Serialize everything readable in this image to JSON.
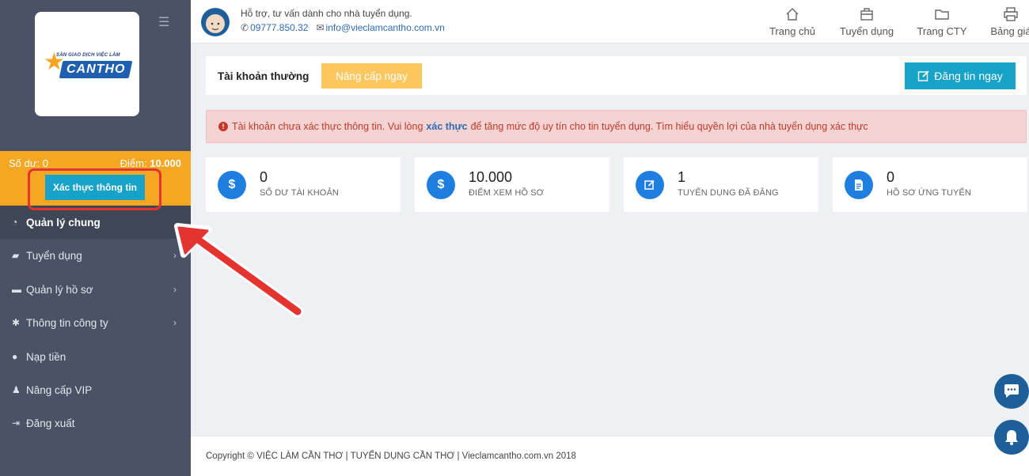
{
  "brand": {
    "logo_tagline": "SÀN GIAO DỊCH VIỆC LÀM",
    "logo_name": "CANTHO"
  },
  "sidebar": {
    "balance_label": "Số dư:",
    "balance_value": "0",
    "points_label": "Điểm:",
    "points_value": "10.000",
    "verify_button": "Xác thực thông tin",
    "items": [
      {
        "label": "Quản lý chung",
        "icon": "dashboard-icon",
        "active": true
      },
      {
        "label": "Tuyển dụng",
        "icon": "briefcase-icon",
        "has_submenu": true
      },
      {
        "label": "Quản lý hồ sơ",
        "icon": "folder-icon",
        "has_submenu": true
      },
      {
        "label": "Thông tin công ty",
        "icon": "gear-icon",
        "has_submenu": true
      },
      {
        "label": "Nạp tiền",
        "icon": "dollar-icon"
      },
      {
        "label": "Nâng cấp VIP",
        "icon": "user-icon"
      },
      {
        "label": "Đăng xuất",
        "icon": "sign-out-icon"
      }
    ]
  },
  "header": {
    "support_text": "Hỗ trợ, tư vấn dành cho nhà tuyển dụng.",
    "phone": "09777.850.32",
    "email": "info@vieclamcantho.com.vn",
    "nav": [
      {
        "label": "Trang chủ",
        "icon": "home-icon"
      },
      {
        "label": "Tuyển dụng",
        "icon": "briefcase-icon"
      },
      {
        "label": "Trang CTY",
        "icon": "folder-icon"
      },
      {
        "label": "Bảng giá",
        "icon": "printer-icon"
      }
    ]
  },
  "account": {
    "type_label": "Tài khoản thường",
    "upgrade_button": "Nâng cấp ngay",
    "post_button": "Đăng tin ngay"
  },
  "alert": {
    "text_before": "Tài khoản chưa xác thực thông tin. Vui lòng",
    "link": "xác thực",
    "text_after": "để tăng mức độ uy tín cho tin tuyển dụng. Tìm hiểu quyền lợi của nhà tuyển dụng xác thực"
  },
  "stats": [
    {
      "value": "0",
      "label": "SỐ DƯ TÀI KHOẢN",
      "icon": "dollar-icon"
    },
    {
      "value": "10.000",
      "label": "ĐIỂM XEM HỒ SƠ",
      "icon": "dollar-icon"
    },
    {
      "value": "1",
      "label": "TUYỂN DỤNG ĐÃ ĐĂNG",
      "icon": "edit-icon"
    },
    {
      "value": "0",
      "label": "HỒ SƠ ỨNG TUYỂN",
      "icon": "document-icon"
    }
  ],
  "footer": {
    "text": "Copyright © VIỆC LÀM CẦN THƠ | TUYỂN DỤNG CẦN THƠ | Vieclamcantho.com.vn 2018"
  },
  "colors": {
    "sidebar_bg": "#4a5366",
    "accent_orange": "#f5a623",
    "primary_blue": "#17a2c8",
    "stat_icon_blue": "#1f7fe0",
    "alert_bg": "#f5d3d3",
    "annotation_red": "#e3342f"
  }
}
